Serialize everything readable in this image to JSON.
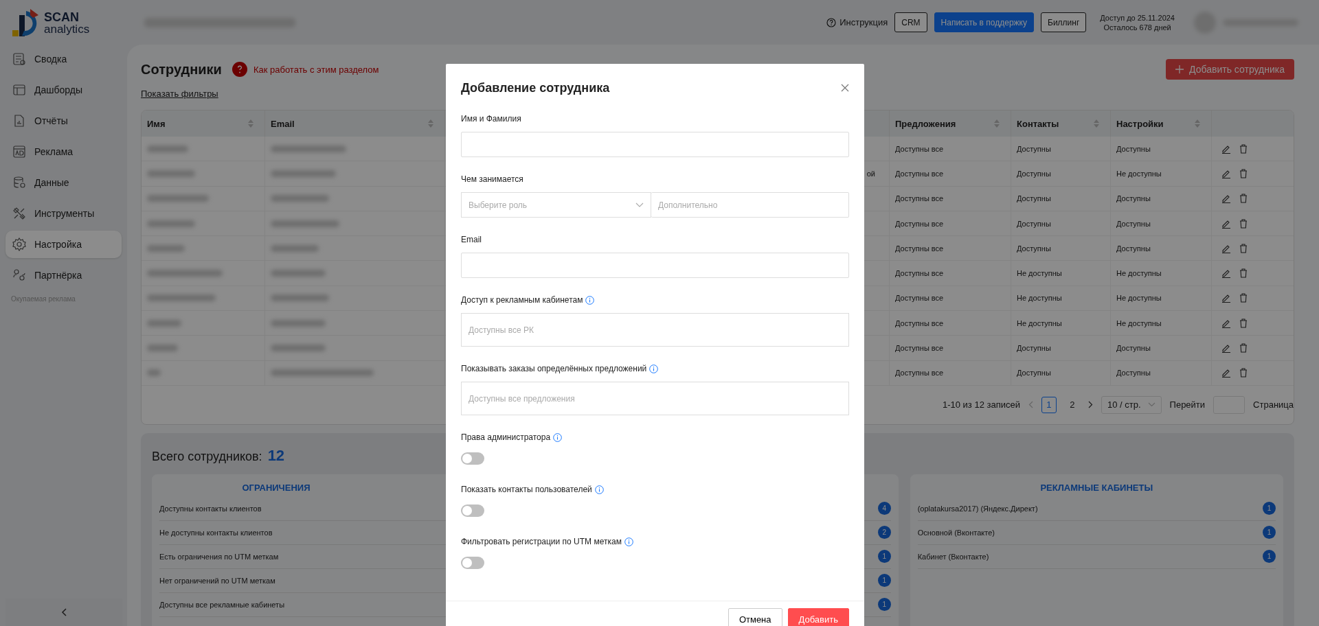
{
  "header": {
    "logo": {
      "word": "SCAN",
      "subword": "analytics"
    },
    "help_link": "Инструкция",
    "buttons": [
      {
        "label": "CRM",
        "kind": "outline"
      },
      {
        "label": "Написать в поддержку",
        "kind": "primary"
      },
      {
        "label": "Биллинг",
        "kind": "outline"
      }
    ],
    "access": [
      "Доступ до 25.11.2024",
      "Осталось 678 дней"
    ]
  },
  "sidebar": {
    "items": [
      {
        "label": "Сводка",
        "selected": false
      },
      {
        "label": "Дашборды",
        "selected": false
      },
      {
        "label": "Отчёты",
        "selected": false
      },
      {
        "label": "Реклама",
        "selected": false
      },
      {
        "label": "Данные",
        "selected": false
      },
      {
        "label": "Инструменты",
        "selected": false
      },
      {
        "label": "Настройка",
        "selected": true
      },
      {
        "label": "Партнёрка",
        "selected": false
      }
    ],
    "caption": "Окупаемая реклама"
  },
  "page": {
    "title": "Сотрудники",
    "help_link": "Как работать с этим разделом",
    "filters_link": "Показать фильтры",
    "add_button": "Добавить сотрудника"
  },
  "table": {
    "columns": {
      "name": "Имя",
      "email": "Email",
      "offers": "Предложения",
      "contacts": "Контакты",
      "settings": "Настройки"
    },
    "rows": [
      {
        "offers": "Доступны все",
        "contacts": "Доступны",
        "settings": "Доступны"
      },
      {
        "column_3": "ой",
        "offers": "Доступны все",
        "contacts": "Доступны",
        "settings": "Не доступны"
      },
      {
        "offers": "Доступны все",
        "contacts": "Доступны",
        "settings": "Доступны"
      },
      {
        "offers": "Доступны все",
        "contacts": "Доступны",
        "settings": "Доступны"
      },
      {
        "offers": "Доступны все",
        "contacts": "Доступны",
        "settings": "Доступны"
      },
      {
        "offers": "Доступны все",
        "contacts": "Не доступны",
        "settings": "Не доступны"
      },
      {
        "offers": "Доступны все",
        "contacts": "Не доступны",
        "settings": "Не доступны"
      },
      {
        "offers": "Доступны все",
        "contacts": "Не доступны",
        "settings": "Не доступны"
      },
      {
        "offers": "Доступны все",
        "contacts": "Доступны",
        "settings": "Доступны"
      },
      {
        "offers": "Доступны все",
        "contacts": "Доступны",
        "settings": "Доступны"
      }
    ]
  },
  "pagination": {
    "summary": "1-10 из 12 записей",
    "pages": [
      {
        "label": "1",
        "selected": true
      },
      {
        "label": "2",
        "selected": false
      }
    ],
    "page_size": "10 / стр.",
    "goto_label": "Перейти",
    "goto_suffix": "Страница"
  },
  "summary": {
    "title": "Всего сотрудников:",
    "count": "12",
    "cards": [
      {
        "title": "ОГРАНИЧЕНИЯ",
        "rows": [
          {
            "label": "Доступны контакты клиентов",
            "count": "4"
          },
          {
            "label": "Не доступны контакты клиентов",
            "count": "2"
          },
          {
            "label": "Есть ограничения по UTM меткам",
            "count": "1"
          },
          {
            "label": "Нет ограничений по UTM меткам",
            "count": "1"
          },
          {
            "label": "Доступны все рекламные кабинеты",
            "count": "1"
          }
        ]
      },
      {
        "title": "РЕКЛАМНЫЕ КАБИНЕТЫ",
        "rows": [
          {
            "label": "(oplatakursa2017) (Яндекс.Директ)",
            "count": "1"
          },
          {
            "label": "Основной (Вконтакте)",
            "count": "1"
          },
          {
            "label": "Кабинет (Вконтакте)",
            "count": "1"
          }
        ]
      }
    ]
  },
  "modal": {
    "title": "Добавление сотрудника",
    "fields": [
      {
        "kind": "text",
        "label": "Имя и Фамилия",
        "info": false
      },
      {
        "kind": "select_pair",
        "label": "Чем занимается",
        "info": false,
        "placeholder": "Выберите роль",
        "placeholder_2": "Дополнительно"
      },
      {
        "kind": "text",
        "label": "Email",
        "info": false
      },
      {
        "kind": "multiselect",
        "label": "Доступ к рекламным кабинетам",
        "info": true,
        "placeholder": "Доступны все РК"
      },
      {
        "kind": "multiselect",
        "label": "Показывать заказы определённых предложений",
        "info": true,
        "placeholder": "Доступны все предложения"
      },
      {
        "kind": "toggle",
        "label": "Права администратора",
        "info": true,
        "on": false
      },
      {
        "kind": "toggle",
        "label": "Показать контакты пользователей",
        "info": true,
        "on": false
      },
      {
        "kind": "toggle",
        "label": "Фильтровать регистрации по UTM меткам",
        "info": true,
        "on": false
      }
    ],
    "cancel_button": "Отмена",
    "submit_button": "Добавить"
  }
}
